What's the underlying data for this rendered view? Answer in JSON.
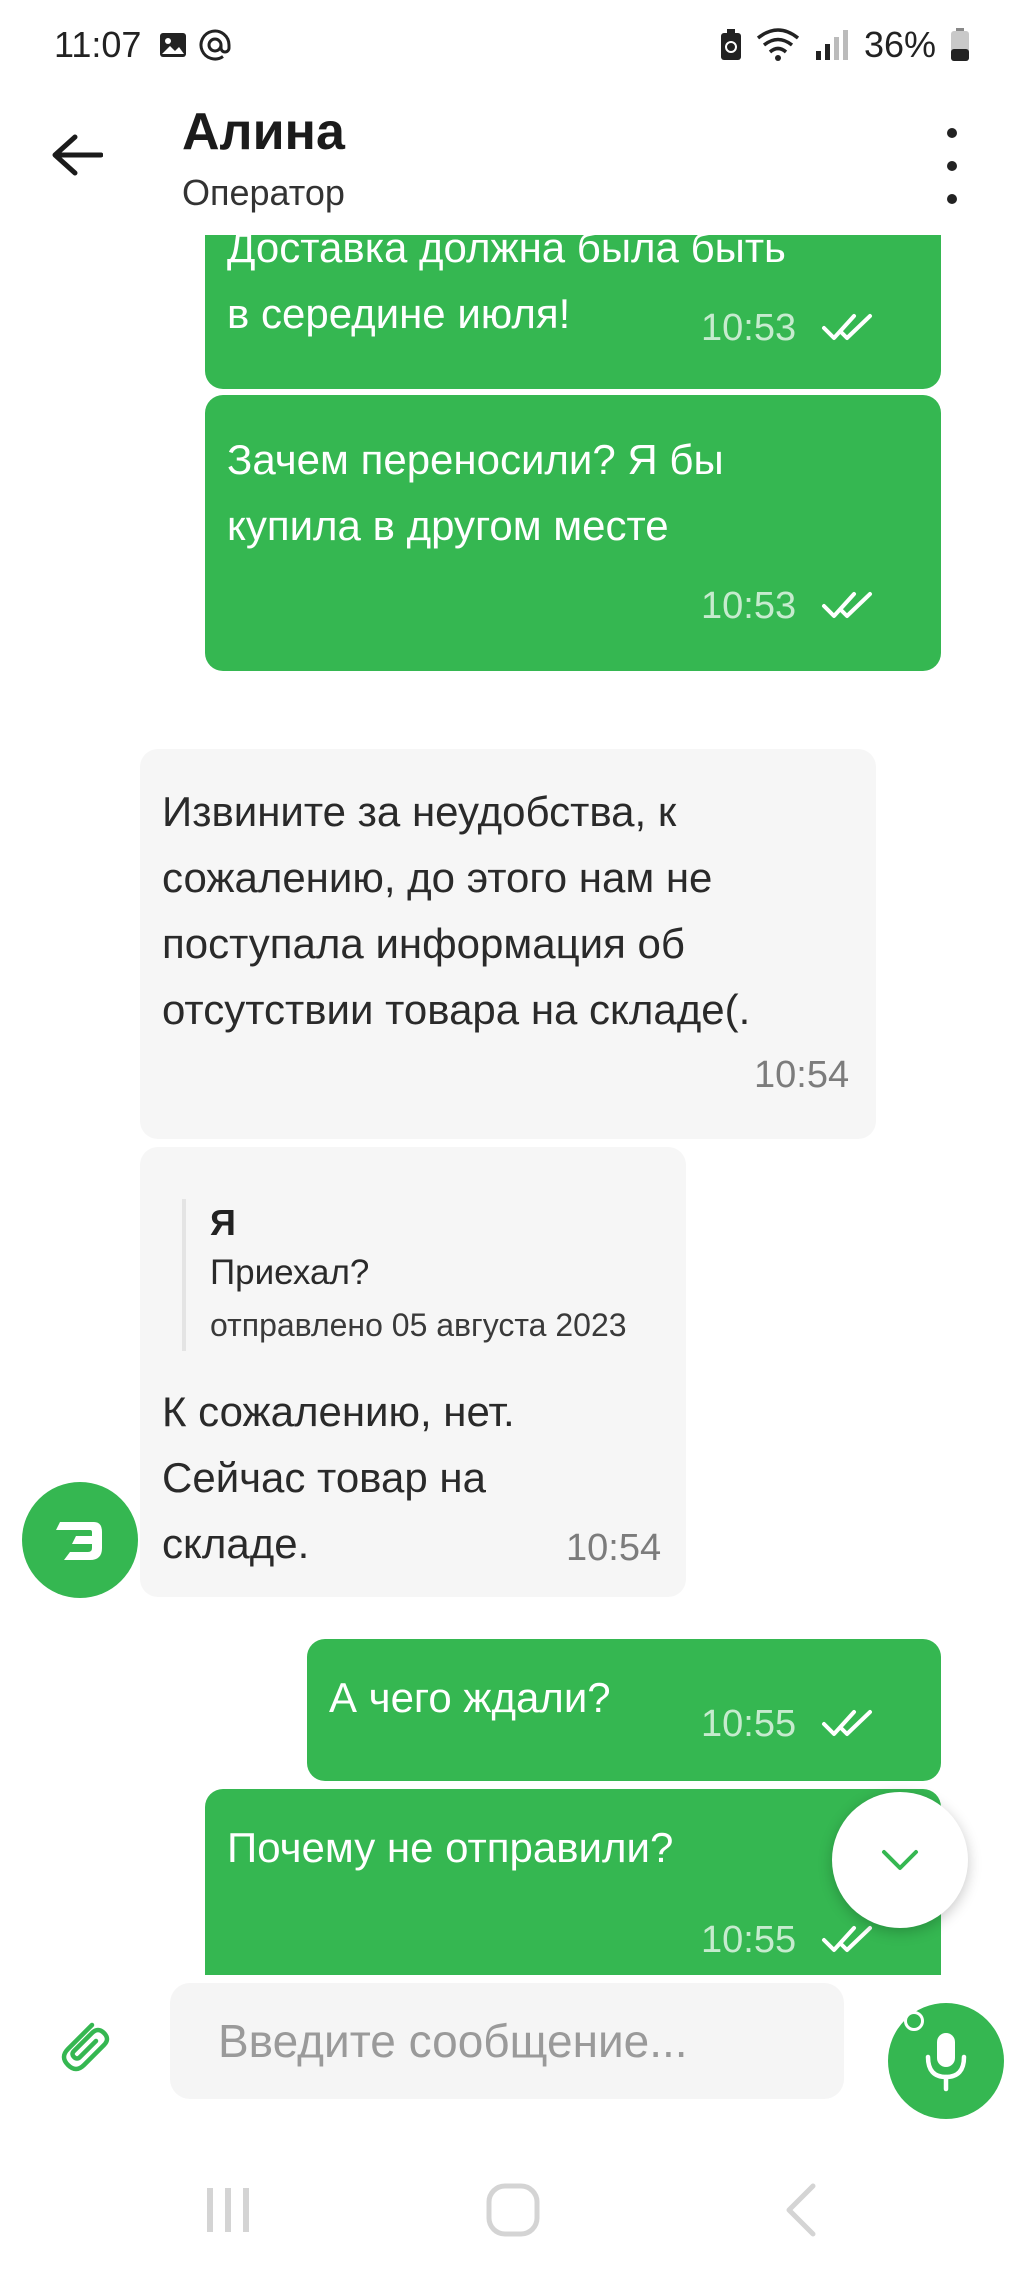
{
  "status_bar": {
    "time": "11:07",
    "battery": "36%",
    "icons": [
      "image-icon",
      "at-icon",
      "battery-saver-icon",
      "wifi-icon",
      "signal-icon",
      "battery-icon"
    ]
  },
  "header": {
    "name": "Алина",
    "role": "Оператор",
    "back_icon": "arrow-left-icon",
    "menu_icon": "more-vertical-icon"
  },
  "messages": [
    {
      "side": "out",
      "lines": [
        "Доставка должна была быть",
        "в середине июля!"
      ],
      "time": "10:53",
      "status": "read"
    },
    {
      "side": "out",
      "lines": [
        "Зачем переносили? Я бы",
        "купила в другом месте"
      ],
      "time": "10:53",
      "status": "read"
    },
    {
      "side": "in",
      "lines": [
        "Извините за неудобства, к",
        "сожалению, до этого нам не",
        "поступала информация об",
        "отсутствии товара на складе(."
      ],
      "time": "10:54"
    },
    {
      "side": "in",
      "reply": {
        "author": "Я",
        "text": "Приехал?",
        "sent": "отправлено 05 августа 2023"
      },
      "lines": [
        "К сожалению, нет.",
        "Сейчас товар на",
        "складе."
      ],
      "time": "10:54"
    },
    {
      "side": "out",
      "lines": [
        "А чего ждали?"
      ],
      "time": "10:55",
      "status": "read"
    },
    {
      "side": "out",
      "lines": [
        "Почему не отправили?"
      ],
      "time": "10:55",
      "status": "read"
    }
  ],
  "composer": {
    "placeholder": "Введите сообщение...",
    "attach_icon": "paperclip-icon",
    "mic_icon": "microphone-icon"
  },
  "colors": {
    "accent": "#35b751",
    "incoming_bubble": "#f6f6f6",
    "outgoing_text": "#ffffff"
  }
}
